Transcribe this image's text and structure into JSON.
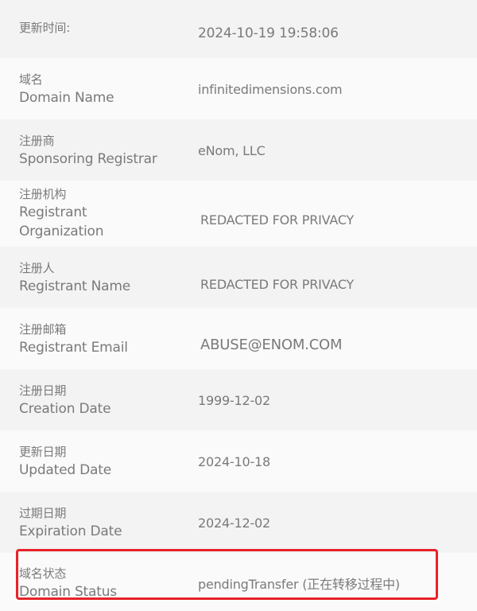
{
  "update_time": {
    "label_zh": "更新时间:",
    "value": "2024-10-19 19:58:06"
  },
  "rows": [
    {
      "label_zh": "域名",
      "label_en": "Domain Name",
      "value": "infinitedimensions.com"
    },
    {
      "label_zh": "注册商",
      "label_en": "Sponsoring Registrar",
      "value": "eNom, LLC"
    },
    {
      "label_zh": "注册机构",
      "label_en": "Registrant Organization",
      "label_en_line1": "Registrant",
      "label_en_line2": "Organization",
      "value": "REDACTED FOR PRIVACY"
    },
    {
      "label_zh": "注册人",
      "label_en": "Registrant Name",
      "value": "REDACTED FOR PRIVACY"
    },
    {
      "label_zh": "注册邮箱",
      "label_en": "Registrant Email",
      "value": "ABUSE@ENOM.COM"
    },
    {
      "label_zh": "注册日期",
      "label_en": "Creation Date",
      "value": "1999-12-02"
    },
    {
      "label_zh": "更新日期",
      "label_en": "Updated Date",
      "value": "2024-10-18"
    },
    {
      "label_zh": "过期日期",
      "label_en": "Expiration Date",
      "value": "2024-12-02"
    },
    {
      "label_zh": "域名状态",
      "label_en": "Domain Status",
      "value": "pendingTransfer (正在转移过程中)"
    }
  ],
  "highlight": {
    "target": "Domain Status",
    "color": "#e8222a"
  },
  "colors": {
    "row_alt": "#f3f3f3",
    "row_base": "#fafafa",
    "text": "#7a7a7a"
  }
}
